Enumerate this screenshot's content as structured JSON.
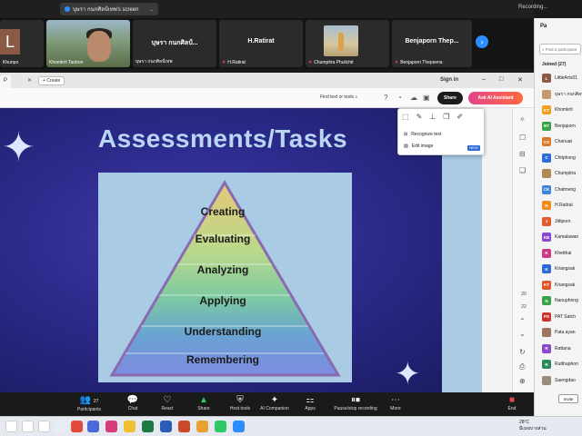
{
  "zoom": {
    "screen_share_label": "บุษรา กนกศิลป์เทพ's screen",
    "recording_label": "Recording...",
    "next_icon": "chevron-right-icon"
  },
  "video_strip": {
    "tiles": [
      {
        "name": "Khunpo",
        "initial": "L",
        "muted": false
      },
      {
        "name": "Khomkrit Taobon",
        "muted": false
      },
      {
        "name": "บุษรา กนกศิลป์เทพ",
        "display": "บุษรา กนกศิลป์...",
        "muted": false
      },
      {
        "name": "H.Ratirat",
        "display": "H.Ratirat",
        "muted": true
      },
      {
        "name": "Chumpitra Phulichit",
        "muted": true
      },
      {
        "name": "Benjaporn Thepsena",
        "display": "Benjaporn  Thep...",
        "muted": true
      }
    ]
  },
  "browser": {
    "tab_label": "P",
    "create_label": "+ Create",
    "sign_in": "Sign in",
    "find_placeholder": "Find text or tools",
    "share_label": "Share",
    "ai_label": "Ask AI Assistant",
    "window_controls": [
      "–",
      "□",
      "✕"
    ]
  },
  "menu": {
    "items": [
      {
        "label": "Recognize text",
        "icon": "ocr-icon"
      },
      {
        "label": "Edit image",
        "icon": "edit-image-icon",
        "badge": "NEW"
      }
    ]
  },
  "slide": {
    "title": "Assessments/Tasks",
    "levels": [
      "Creating",
      "Evaluating",
      "Analyzing",
      "Applying",
      "Understanding",
      "Remembering"
    ],
    "level_colors": [
      "#e3c87a",
      "#cfd98a",
      "#a8d690",
      "#72c4a8",
      "#6aa2d4",
      "#7f8be0"
    ]
  },
  "page_nav": {
    "current": "20",
    "total": "22"
  },
  "bottom_bar": {
    "buttons": [
      {
        "label": "Participants",
        "count": "27",
        "icon": "participants-icon"
      },
      {
        "label": "Chat",
        "icon": "chat-icon"
      },
      {
        "label": "React",
        "icon": "react-icon"
      },
      {
        "label": "Share",
        "icon": "share-screen-icon"
      },
      {
        "label": "Host tools",
        "icon": "host-tools-icon"
      },
      {
        "label": "AI Companion",
        "icon": "ai-companion-icon"
      },
      {
        "label": "Apps",
        "icon": "apps-icon"
      },
      {
        "label": "Pause/stop recording",
        "icon": "record-icon"
      },
      {
        "label": "More",
        "icon": "more-icon"
      },
      {
        "label": "End",
        "icon": "end-icon"
      }
    ]
  },
  "participants": {
    "header": "Pa",
    "search_placeholder": "Find a participant",
    "joined_label": "Joined (27)",
    "list": [
      {
        "initial": "L",
        "name": "LittleArts01",
        "color": "#8a5a44"
      },
      {
        "initial": "",
        "name": "บุษรา กนกศิลป์",
        "color": "#c29a6b"
      },
      {
        "initial": "KT",
        "name": "Khomkrit",
        "color": "#f0a020"
      },
      {
        "initial": "BT",
        "name": "Benjaporn",
        "color": "#3aa34a"
      },
      {
        "initial": "CS",
        "name": "Chanuat",
        "color": "#d97a2b"
      },
      {
        "initial": "C",
        "name": "Chitphong",
        "color": "#2d6bd8"
      },
      {
        "initial": "",
        "name": "Chumpitra",
        "color": "#b08a55"
      },
      {
        "initial": "CK",
        "name": "Chatmeng",
        "color": "#3f86d9"
      },
      {
        "initial": "H",
        "name": "H.Ratirat",
        "color": "#f08c1a"
      },
      {
        "initial": "J",
        "name": "Jittiporn",
        "color": "#e25b2c"
      },
      {
        "initial": "KB",
        "name": "Kamalawan",
        "color": "#8a4ac9"
      },
      {
        "initial": "K",
        "name": "Khetthai",
        "color": "#c93c83"
      },
      {
        "initial": "K",
        "name": "Kriangsak",
        "color": "#2d6bd8"
      },
      {
        "initial": "KT",
        "name": "Kriangsak",
        "color": "#e0562a"
      },
      {
        "initial": "N",
        "name": "Nanuphong",
        "color": "#3aa34a"
      },
      {
        "initial": "PS",
        "name": "PAT Satch",
        "color": "#c9352b"
      },
      {
        "initial": "",
        "name": "Pata ayan",
        "color": "#a07560"
      },
      {
        "initial": "R",
        "name": "Rattana",
        "color": "#8a4ac9"
      },
      {
        "initial": "R",
        "name": "Rutthaphon",
        "color": "#2d8a5b"
      },
      {
        "initial": "",
        "name": "Saengdao",
        "color": "#9a8c7a"
      }
    ],
    "invite_label": "Invite"
  },
  "taskbar": {
    "weather_temp": "28°C",
    "weather_desc": "มีเมฆบางส่วน"
  }
}
